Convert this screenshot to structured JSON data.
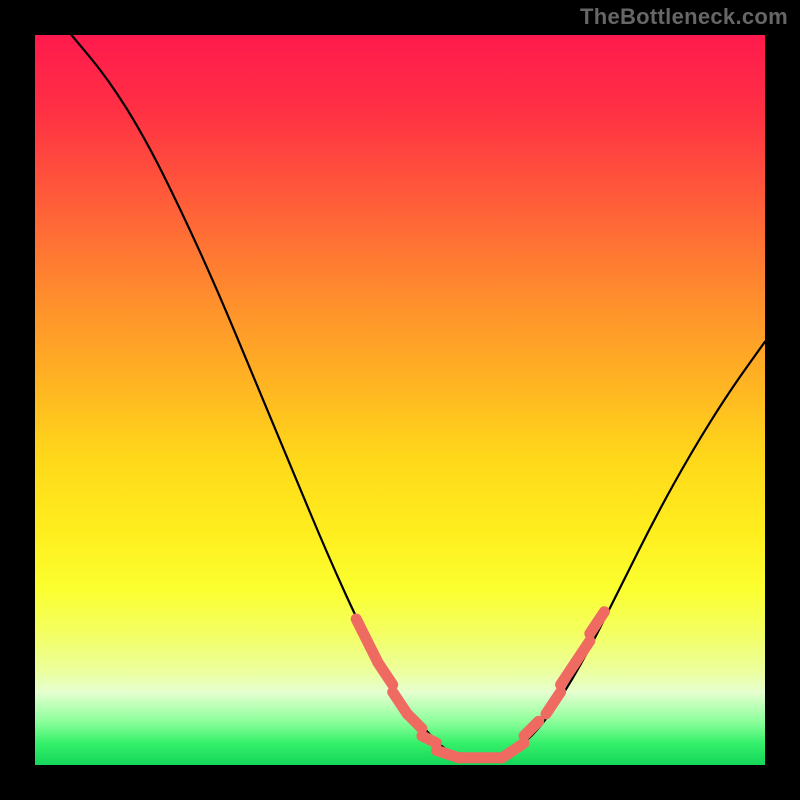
{
  "watermark": "TheBottleneck.com",
  "chart_data": {
    "type": "line",
    "title": "",
    "xlabel": "",
    "ylabel": "",
    "xlim": [
      0,
      100
    ],
    "ylim": [
      0,
      100
    ],
    "grid": false,
    "curve": [
      {
        "x": 5,
        "y": 100
      },
      {
        "x": 10,
        "y": 94
      },
      {
        "x": 15,
        "y": 86
      },
      {
        "x": 20,
        "y": 76
      },
      {
        "x": 25,
        "y": 65
      },
      {
        "x": 30,
        "y": 53
      },
      {
        "x": 35,
        "y": 41
      },
      {
        "x": 40,
        "y": 29
      },
      {
        "x": 45,
        "y": 18
      },
      {
        "x": 50,
        "y": 9
      },
      {
        "x": 55,
        "y": 3
      },
      {
        "x": 58,
        "y": 1
      },
      {
        "x": 62,
        "y": 1
      },
      {
        "x": 66,
        "y": 2
      },
      {
        "x": 70,
        "y": 6
      },
      {
        "x": 75,
        "y": 14
      },
      {
        "x": 80,
        "y": 24
      },
      {
        "x": 85,
        "y": 34
      },
      {
        "x": 90,
        "y": 43
      },
      {
        "x": 95,
        "y": 51
      },
      {
        "x": 100,
        "y": 58
      }
    ],
    "highlight_segments": [
      {
        "x0": 44,
        "y0": 20,
        "x1": 47,
        "y1": 14
      },
      {
        "x0": 47,
        "y0": 14,
        "x1": 49,
        "y1": 11
      },
      {
        "x0": 49,
        "y0": 10,
        "x1": 51,
        "y1": 7
      },
      {
        "x0": 51,
        "y0": 7,
        "x1": 53,
        "y1": 5
      },
      {
        "x0": 53,
        "y0": 4,
        "x1": 55,
        "y1": 3
      },
      {
        "x0": 55,
        "y0": 2,
        "x1": 58,
        "y1": 1
      },
      {
        "x0": 58,
        "y0": 1,
        "x1": 61,
        "y1": 1
      },
      {
        "x0": 61,
        "y0": 1,
        "x1": 64,
        "y1": 1
      },
      {
        "x0": 64,
        "y0": 1,
        "x1": 67,
        "y1": 3
      },
      {
        "x0": 67,
        "y0": 4,
        "x1": 69,
        "y1": 6
      },
      {
        "x0": 70,
        "y0": 7,
        "x1": 72,
        "y1": 10
      },
      {
        "x0": 72,
        "y0": 11,
        "x1": 74,
        "y1": 14
      },
      {
        "x0": 74,
        "y0": 14,
        "x1": 76,
        "y1": 17
      },
      {
        "x0": 76,
        "y0": 18,
        "x1": 78,
        "y1": 21
      }
    ],
    "colors": {
      "curve": "#000000",
      "highlight": "#ef6b62",
      "gradient_top": "#ff1a4d",
      "gradient_mid": "#ffee1e",
      "gradient_bottom": "#14d659",
      "background": "#000000"
    }
  }
}
